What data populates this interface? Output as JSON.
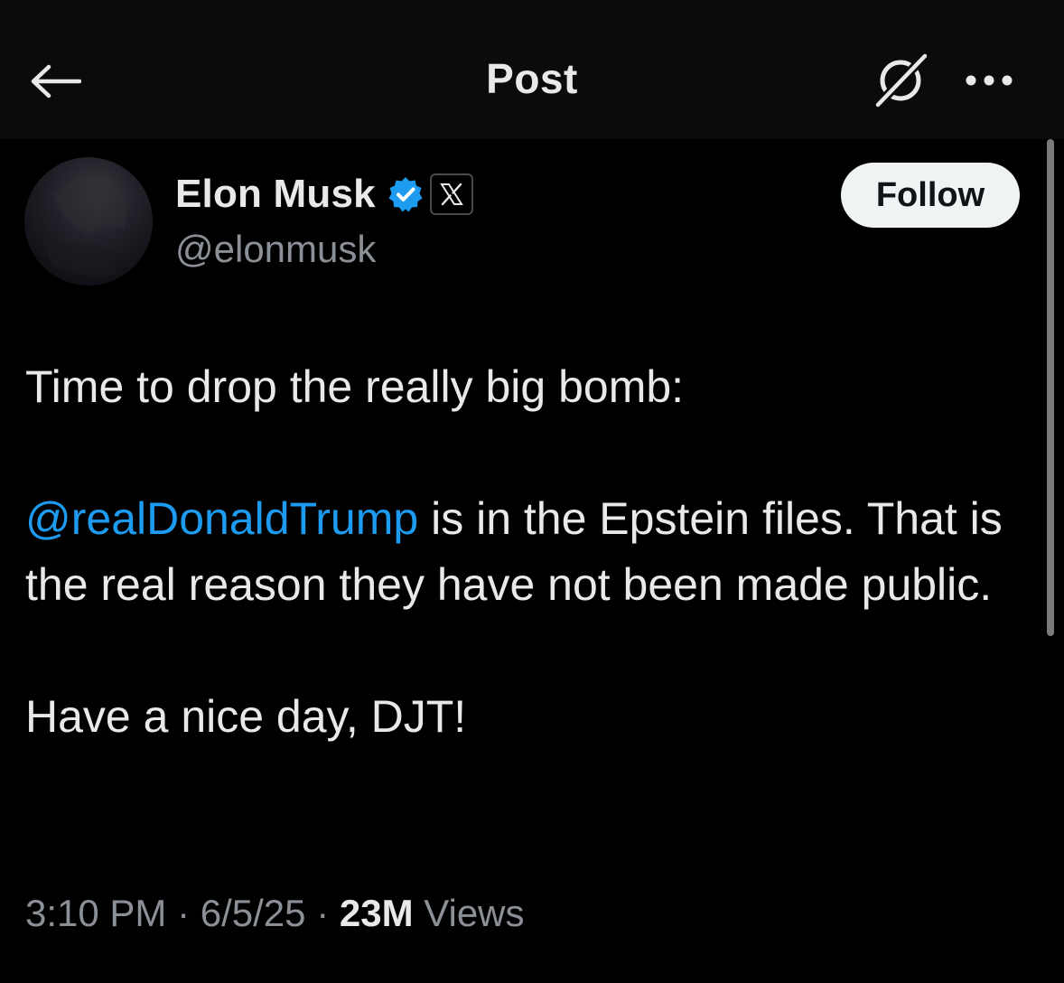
{
  "header": {
    "title": "Post",
    "back_icon": "arrow-left-icon",
    "grok_icon": "grok-icon",
    "more_icon": "more-horizontal-icon"
  },
  "author": {
    "name": "Elon Musk",
    "handle": "@elonmusk",
    "verified_icon": "verified-badge-icon",
    "affiliate_icon": "x-logo-icon",
    "verified_color": "#1d9bf0"
  },
  "follow_button": {
    "label": "Follow"
  },
  "post": {
    "line1": "Time to drop the really big bomb:",
    "mention": "@realDonaldTrump",
    "line2_rest": " is in the Epstein files. That is the real reason they have not been made public.",
    "line3": "Have a nice day, DJT!",
    "mention_color": "#1d9bf0"
  },
  "meta": {
    "time": "3:10 PM",
    "separator": " · ",
    "date": "6/5/25",
    "views_count": "23M",
    "views_label": " Views"
  }
}
